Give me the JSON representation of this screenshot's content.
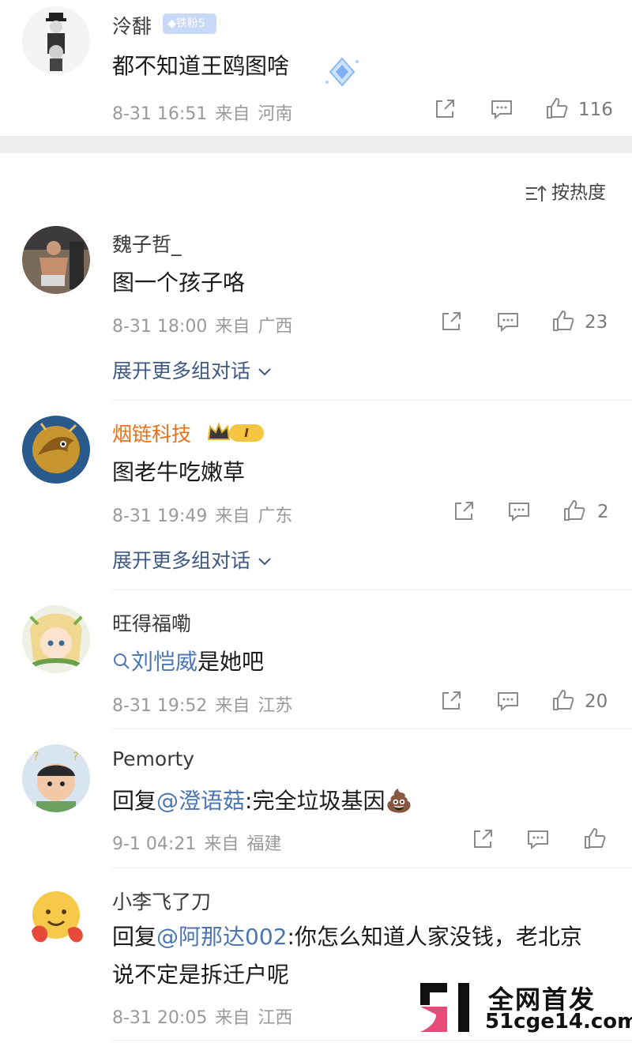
{
  "top_comment": {
    "name": "泠馡",
    "fan_badge": "铁粉5",
    "text": "都不知道王鸥图啥",
    "date": "8-31 16:51",
    "from": "来自",
    "location": "河南",
    "likes": "116"
  },
  "sort": {
    "label": "按热度"
  },
  "comments": [
    {
      "name": "魏子哲_",
      "text": "图一个孩子咯",
      "date": "8-31 18:00",
      "from": "来自",
      "location": "广西",
      "likes": "23",
      "expand": "展开更多组对话"
    },
    {
      "name": "烟链科技",
      "badge": "I",
      "text": "图老牛吃嫩草",
      "date": "8-31 19:49",
      "from": "来自",
      "location": "广东",
      "likes": "2",
      "expand": "展开更多组对话"
    },
    {
      "name": "旺得福嘞",
      "search_term": "刘恺威",
      "text_tail": "是她吧",
      "date": "8-31 19:52",
      "from": "来自",
      "location": "江苏",
      "likes": "20"
    },
    {
      "name": "Pemorty",
      "reply_prefix": "回复",
      "mention": "@澄语菇",
      "text_tail": ":完全垃圾基因",
      "emoji": "💩",
      "date": "9-1 04:21",
      "from": "来自",
      "location": "福建",
      "likes": ""
    },
    {
      "name": "小李飞了刀",
      "reply_prefix": "回复",
      "mention": "@阿那达002",
      "text_tail": ":你怎么知道人家没钱，老北京说不定是拆迁户呢",
      "date": "8-31 20:05",
      "from": "来自",
      "location": "江西"
    }
  ],
  "watermark": {
    "title": "全网首发",
    "site": "51cge14.com"
  },
  "colors": {
    "link": "#4c76b2",
    "expand": "#3e5a83",
    "vip_name": "#e8711c",
    "meta": "#9a9a9a",
    "band": "#efefef"
  }
}
